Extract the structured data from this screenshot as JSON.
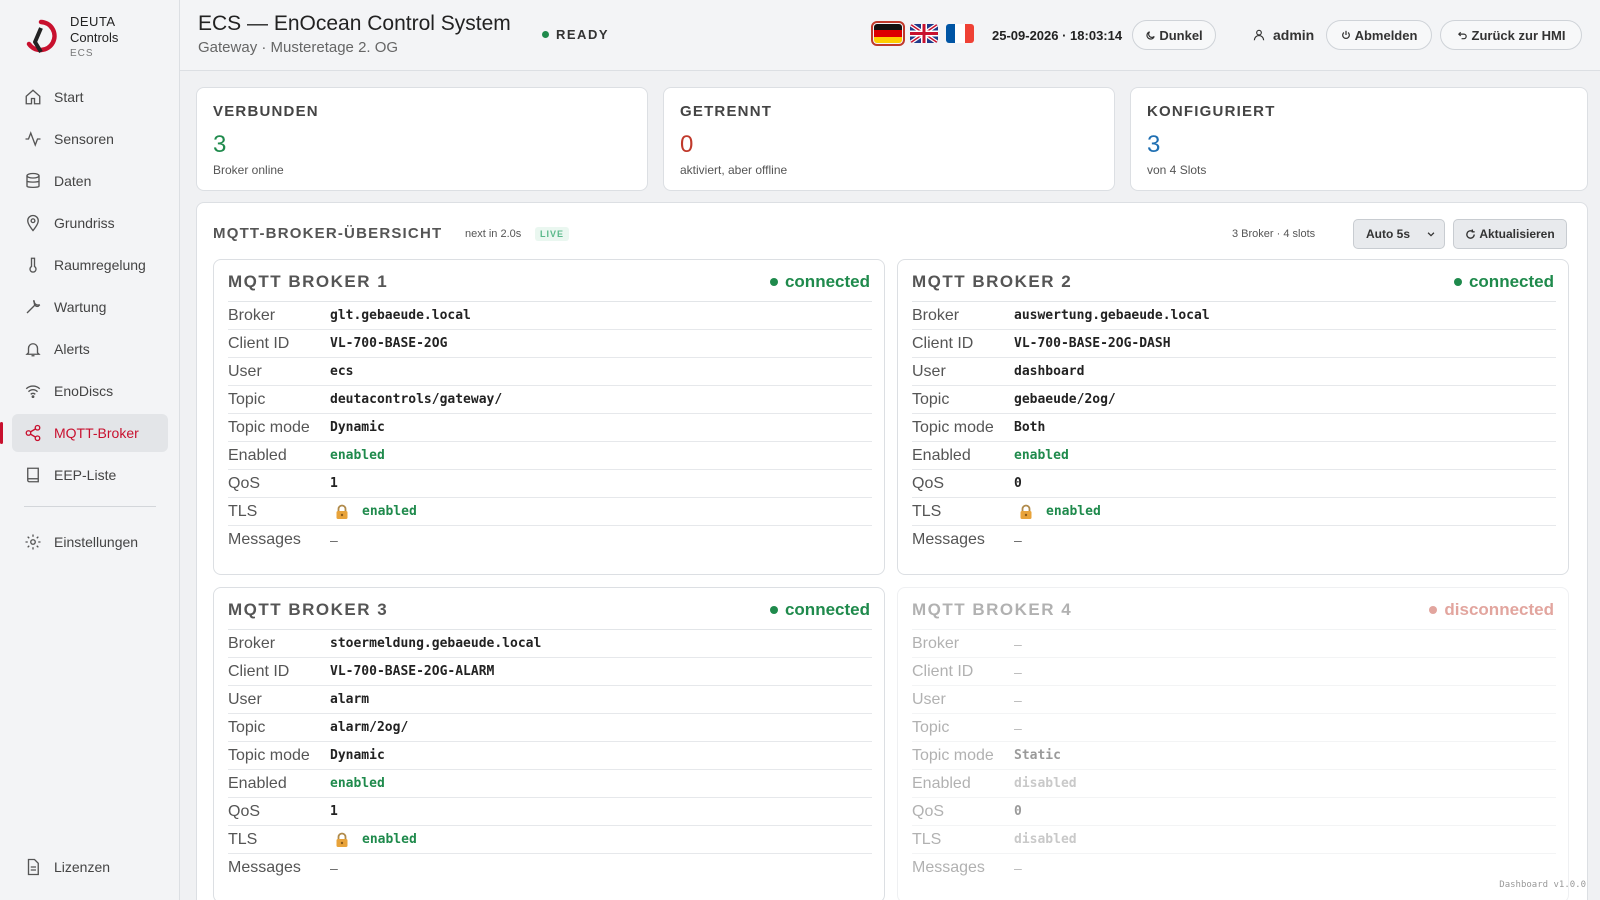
{
  "brand": {
    "line1": "DEUTA",
    "line2": "Controls",
    "line3": "ECS",
    "accent": "#c8102e"
  },
  "nav": {
    "items": [
      {
        "label": "Start",
        "icon": "home-icon"
      },
      {
        "label": "Sensoren",
        "icon": "activity-icon"
      },
      {
        "label": "Daten",
        "icon": "database-icon"
      },
      {
        "label": "Grundriss",
        "icon": "map-pin-icon"
      },
      {
        "label": "Raumregelung",
        "icon": "thermometer-icon"
      },
      {
        "label": "Wartung",
        "icon": "wrench-icon"
      },
      {
        "label": "Alerts",
        "icon": "bell-icon"
      },
      {
        "label": "EnoDiscs",
        "icon": "wifi-icon"
      },
      {
        "label": "MQTT-Broker",
        "icon": "share-icon",
        "active": true
      },
      {
        "label": "EEP-Liste",
        "icon": "book-icon"
      }
    ],
    "settings": "Einstellungen",
    "licenses": "Lizenzen"
  },
  "header": {
    "title": "ECS — EnOcean Control System",
    "subtitle": "Gateway · Musteretage 2. OG",
    "status": "READY",
    "datetime": "25-09-2026 · 18:03:14",
    "theme_label": "Dunkel",
    "user": "admin",
    "logout_label": "Abmelden",
    "back_label": "Zurück zur HMI",
    "languages": [
      "de",
      "en",
      "fr"
    ],
    "active_language": "de"
  },
  "stats": [
    {
      "label": "VERBUNDEN",
      "value": "3",
      "desc": "Broker online",
      "color": "#1f8a4c"
    },
    {
      "label": "GETRENNT",
      "value": "0",
      "desc": "aktiviert, aber offline",
      "color": "#c0392b"
    },
    {
      "label": "KONFIGURIERT",
      "value": "3",
      "desc": "von 4 Slots",
      "color": "#1f6fb2"
    }
  ],
  "panel": {
    "title": "MQTT-BROKER-ÜBERSICHT",
    "next": "next in 2.0s",
    "live": "LIVE",
    "count": "3 Broker · 4 slots",
    "interval": "Auto 5s",
    "refresh_label": "Aktualisieren"
  },
  "row_labels": {
    "broker": "Broker",
    "client_id": "Client ID",
    "user": "User",
    "topic": "Topic",
    "topic_mode": "Topic mode",
    "enabled": "Enabled",
    "qos": "QoS",
    "tls": "TLS",
    "messages": "Messages"
  },
  "brokers": [
    {
      "title": "MQTT BROKER 1",
      "status": "connected",
      "status_color": "#1f8a4c",
      "broker": "glt.gebaeude.local",
      "client_id": "VL-700-BASE-2OG",
      "user": "ecs",
      "topic": "deutacontrols/gateway/",
      "topic_mode": "Dynamic",
      "enabled": "enabled",
      "qos": "1",
      "tls": "enabled",
      "messages": "–"
    },
    {
      "title": "MQTT BROKER 2",
      "status": "connected",
      "status_color": "#1f8a4c",
      "broker": "auswertung.gebaeude.local",
      "client_id": "VL-700-BASE-2OG-DASH",
      "user": "dashboard",
      "topic": "gebaeude/2og/",
      "topic_mode": "Both",
      "enabled": "enabled",
      "qos": "0",
      "tls": "enabled",
      "messages": "–"
    },
    {
      "title": "MQTT BROKER 3",
      "status": "connected",
      "status_color": "#1f8a4c",
      "broker": "stoermeldung.gebaeude.local",
      "client_id": "VL-700-BASE-2OG-ALARM",
      "user": "alarm",
      "topic": "alarm/2og/",
      "topic_mode": "Dynamic",
      "enabled": "enabled",
      "qos": "1",
      "tls": "enabled",
      "messages": "–"
    },
    {
      "title": "MQTT BROKER 4",
      "status": "disconnected",
      "status_color": "#c0392b",
      "broker": "–",
      "client_id": "–",
      "user": "–",
      "topic": "–",
      "topic_mode": "Static",
      "enabled": "disabled",
      "qos": "0",
      "tls": "disabled",
      "messages": "–"
    }
  ],
  "footer": {
    "version": "Dashboard v1.0.0"
  }
}
